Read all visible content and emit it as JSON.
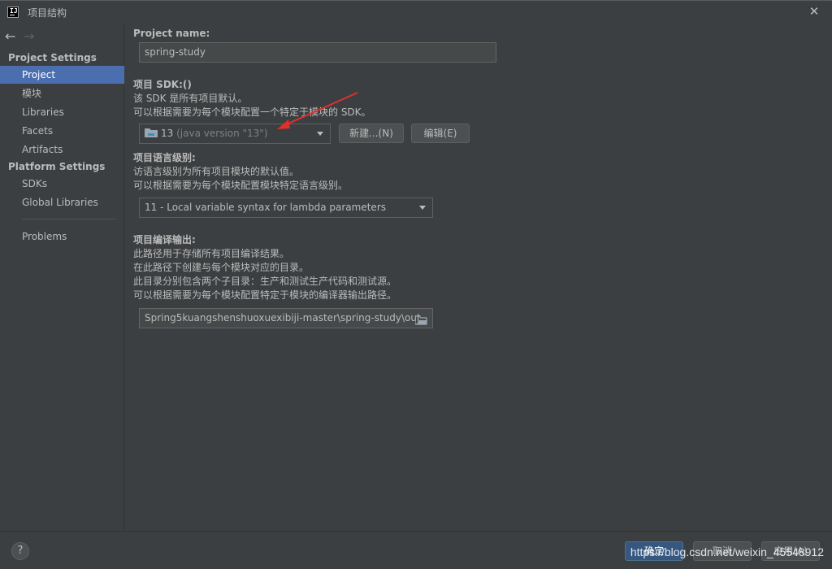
{
  "window": {
    "title": "项目结构",
    "app_icon_text": "IJ"
  },
  "sidebar": {
    "project_settings_header": "Project Settings",
    "project_items": [
      "Project",
      "模块",
      "Libraries",
      "Facets",
      "Artifacts"
    ],
    "platform_settings_header": "Platform Settings",
    "platform_items": [
      "SDKs",
      "Global Libraries"
    ],
    "problems": "Problems",
    "selected": "Project"
  },
  "project_name": {
    "label": "Project name:",
    "value": "spring-study"
  },
  "sdk": {
    "label": "项目 SDK:()",
    "desc1": "该 SDK 是所有项目默认。",
    "desc2": "可以根据需要为每个模块配置一个特定于模块的 SDK。",
    "selected_name": "13",
    "selected_version": "(java version \"13\")",
    "new_button": "新建...(N)",
    "edit_button": "编辑(E)"
  },
  "language_level": {
    "label": "项目语言级别:",
    "desc1": "访语言级别为所有项目模块的默认值。",
    "desc2": "可以根据需要为每个模块配置模块特定语言级别。",
    "value": "11 - Local variable syntax for lambda parameters"
  },
  "compiler_output": {
    "label": "项目编译输出:",
    "desc1": "此路径用于存储所有项目编译结果。",
    "desc2": "在此路径下创建与每个模块对应的目录。",
    "desc3": "此目录分别包含两个子目录：生产和测试生产代码和测试源。",
    "desc4": "可以根据需要为每个模块配置特定于模块的编译器输出路径。",
    "path": "Spring5kuangshenshuoxuexibiji-master\\spring-study\\out"
  },
  "footer": {
    "help": "?",
    "ok": "确定",
    "cancel": "取消",
    "apply": "应用(A)",
    "watermark": "https://blog.csdn.net/weixin_45548912"
  },
  "colors": {
    "accent": "#4b6eaf",
    "annotation_arrow": "#e0302a",
    "background": "#3c3f41"
  }
}
